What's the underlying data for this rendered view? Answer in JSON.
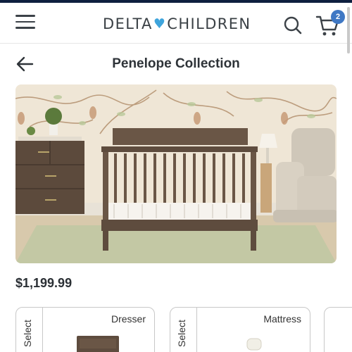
{
  "header": {
    "logo_left": "DELTA",
    "logo_heart": "♥",
    "logo_right": "CHILDREN",
    "cart_count": "2"
  },
  "page": {
    "title": "Penelope Collection"
  },
  "product": {
    "price": "$1,199.99"
  },
  "cards": [
    {
      "title": "Dresser",
      "select_label": "Select"
    },
    {
      "title": "Mattress",
      "select_label": "Select"
    }
  ],
  "colors": {
    "brand_navy": "#0e1f3f",
    "logo_heart": "#3ea4dc",
    "badge": "#3f78c4"
  }
}
